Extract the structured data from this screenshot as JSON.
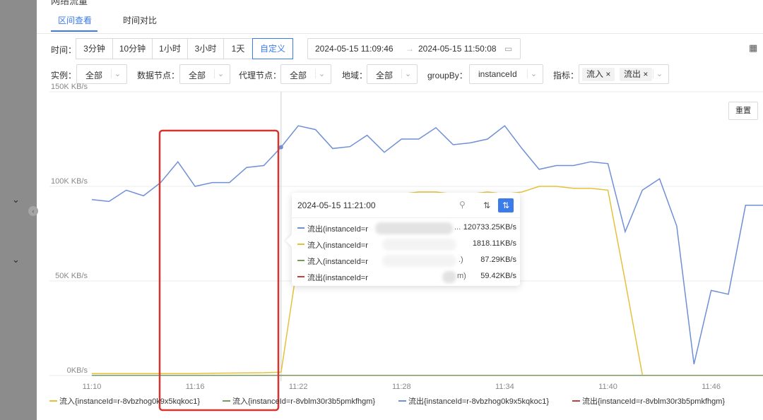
{
  "section_title": "网络流量",
  "tabs": [
    {
      "label": "区间查看",
      "active": true
    },
    {
      "label": "时间对比",
      "active": false
    }
  ],
  "time_label": "时间：",
  "time_options": [
    {
      "label": "3分钟"
    },
    {
      "label": "10分钟"
    },
    {
      "label": "1小时"
    },
    {
      "label": "3小时"
    },
    {
      "label": "1天"
    },
    {
      "label": "自定义",
      "active": true
    }
  ],
  "range": {
    "start": "2024-05-15 11:09:46",
    "arrow": "→",
    "end": "2024-05-15 11:50:08"
  },
  "filters": {
    "instance": {
      "label": "实例：",
      "value": "全部"
    },
    "data_node": {
      "label": "数据节点：",
      "value": "全部"
    },
    "proxy_node": {
      "label": "代理节点：",
      "value": "全部"
    },
    "region": {
      "label": "地域：",
      "value": "全部"
    },
    "groupby": {
      "label": "groupBy：",
      "value": "instanceId"
    },
    "metric": {
      "label": "指标：",
      "tags": [
        "流入 ×",
        "流出 ×"
      ]
    }
  },
  "reset_label": "重置",
  "tooltip": {
    "time": "2024-05-15 11:21:00",
    "rows": [
      {
        "name": "流出(instanceId=r",
        "value": "120733.25KB/s",
        "color": "#6f8fd6",
        "tail": "..."
      },
      {
        "name": "流入(instanceId=r",
        "value": "1818.11KB/s",
        "color": "#e5c13a",
        "tail": ""
      },
      {
        "name": "流入(instanceId=r",
        "value": "87.29KB/s",
        "color": "#7a9a5c",
        "tail": ".)"
      },
      {
        "name": "流出(instanceId=r",
        "value": "59.42KB/s",
        "color": "#c0413b",
        "tail": "m)"
      }
    ]
  },
  "chart_data": {
    "type": "line",
    "y_ticks": [
      "0KB/s",
      "50K KB/s",
      "100K KB/s",
      "150K KB/s"
    ],
    "x_ticks": [
      "11:10",
      "11:16",
      "11:22",
      "11:28",
      "11:34",
      "11:40",
      "11:46"
    ],
    "ylim": [
      0,
      150000
    ],
    "xlim_min": [
      0,
      43
    ],
    "grid": true,
    "hover_minute": 11,
    "series": [
      {
        "name": "流出{instanceId=r-8vbzhog0k9x5kqkoc1}",
        "color": "#6f8fd6",
        "points": [
          [
            0,
            93000
          ],
          [
            1,
            92000
          ],
          [
            2,
            98000
          ],
          [
            3,
            95000
          ],
          [
            4,
            102000
          ],
          [
            5,
            113000
          ],
          [
            6,
            100000
          ],
          [
            7,
            102000
          ],
          [
            8,
            102000
          ],
          [
            9,
            110000
          ],
          [
            10,
            111000
          ],
          [
            11,
            120700
          ],
          [
            12,
            132000
          ],
          [
            13,
            130000
          ],
          [
            14,
            120000
          ],
          [
            15,
            121000
          ],
          [
            16,
            127000
          ],
          [
            17,
            118000
          ],
          [
            18,
            125000
          ],
          [
            19,
            125000
          ],
          [
            20,
            131000
          ],
          [
            21,
            122000
          ],
          [
            22,
            123000
          ],
          [
            23,
            125000
          ],
          [
            24,
            132000
          ],
          [
            25,
            120000
          ],
          [
            26,
            109000
          ],
          [
            27,
            111000
          ],
          [
            28,
            111000
          ],
          [
            29,
            113000
          ],
          [
            30,
            112000
          ],
          [
            31,
            76000
          ],
          [
            32,
            98000
          ],
          [
            33,
            104000
          ],
          [
            34,
            79000
          ],
          [
            35,
            6000
          ],
          [
            36,
            45000
          ],
          [
            37,
            43000
          ],
          [
            38,
            90000
          ],
          [
            39,
            90000
          ],
          [
            40,
            89000
          ]
        ]
      },
      {
        "name": "流入{instanceId=r-8vbzhog0k9x5kqkoc1}",
        "color": "#e5c13a",
        "points": [
          [
            0,
            1000
          ],
          [
            1,
            1000
          ],
          [
            2,
            1000
          ],
          [
            3,
            1000
          ],
          [
            4,
            1000
          ],
          [
            5,
            1000
          ],
          [
            6,
            1000
          ],
          [
            7,
            1200
          ],
          [
            8,
            1300
          ],
          [
            9,
            1400
          ],
          [
            10,
            1500
          ],
          [
            11,
            1800
          ],
          [
            12,
            62000
          ],
          [
            13,
            85000
          ],
          [
            14,
            90000
          ],
          [
            15,
            92000
          ],
          [
            16,
            95000
          ],
          [
            17,
            96000
          ],
          [
            18,
            96000
          ],
          [
            19,
            97000
          ],
          [
            20,
            97000
          ],
          [
            21,
            96000
          ],
          [
            22,
            96000
          ],
          [
            23,
            97000
          ],
          [
            24,
            96000
          ],
          [
            25,
            97000
          ],
          [
            26,
            100000
          ],
          [
            27,
            100000
          ],
          [
            28,
            99000
          ],
          [
            29,
            99000
          ],
          [
            30,
            98000
          ],
          [
            31,
            50000
          ],
          [
            32,
            500
          ]
        ]
      },
      {
        "name": "流入{instanceId=r-8vblm30r3b5pmkfhgm}",
        "color": "#7a9a5c",
        "points": [
          [
            0,
            100
          ],
          [
            11,
            90
          ],
          [
            40,
            90
          ]
        ]
      },
      {
        "name": "流出{instanceId=r-8vblm30r3b5pmkfhgm}",
        "color": "#c0413b",
        "points": [
          [
            0,
            60
          ],
          [
            11,
            60
          ],
          [
            40,
            60
          ]
        ]
      }
    ]
  }
}
